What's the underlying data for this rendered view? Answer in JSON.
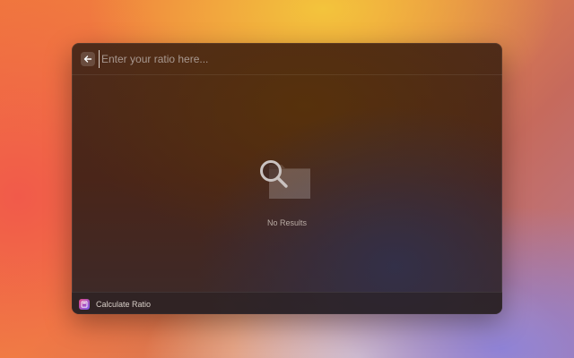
{
  "search": {
    "placeholder": "Enter your ratio here...",
    "value": ""
  },
  "empty_state": {
    "message": "No Results",
    "icon": "magnifier-folder-icon"
  },
  "action_bar": {
    "command_label": "Calculate Ratio",
    "icon": "calculator-icon"
  },
  "icons": {
    "back": "arrow-left-icon"
  },
  "colors": {
    "text_primary": "#d8cfc8",
    "text_muted": "#b8aba4",
    "command_icon_start": "#e24c8a",
    "command_icon_end": "#7b5cf0"
  }
}
